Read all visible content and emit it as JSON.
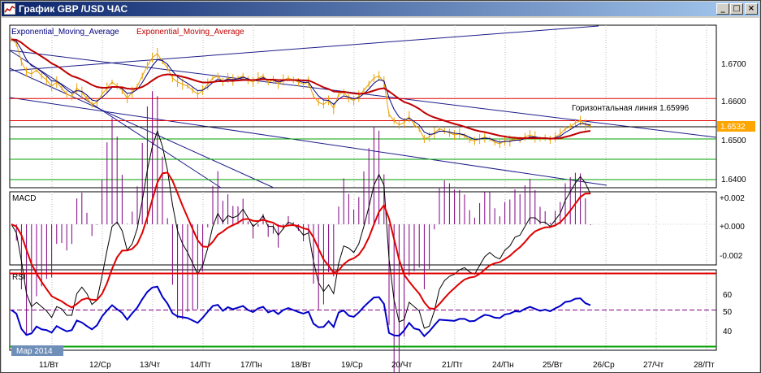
{
  "window": {
    "title": "График GBP /USD  ЧАС",
    "minimize": "_",
    "restore": "□",
    "close": "×"
  },
  "legend": {
    "ema1": "Exponential_Moving_Average",
    "ema2": "Exponential_Moving_Average",
    "ema1_color": "#000080",
    "ema2_color": "#c00000"
  },
  "price_axis": {
    "ticks": [
      "1.6700",
      "1.6600",
      "1.6500",
      "1.6400"
    ],
    "current_price": "1.6532",
    "current_price_color": "#ffa500"
  },
  "annotation": {
    "horizontal_line_label": "Горизонтальная линия 1.65996"
  },
  "macd": {
    "label": "MACD",
    "ticks": [
      "+0.002",
      "+0.000",
      "-0.002"
    ]
  },
  "rsi": {
    "label": "RSI",
    "ticks": [
      "60",
      "50",
      "40"
    ]
  },
  "time_axis": {
    "month_label": "Мар 2014",
    "ticks": [
      "11/Вт",
      "12/Ср",
      "13/Чт",
      "14/Пт",
      "17/Пн",
      "18/Вт",
      "19/Ср",
      "20/Чт",
      "21/Пт",
      "24/Пн",
      "25/Вт",
      "26/Ср",
      "27/Чт",
      "28/Пт"
    ]
  },
  "chart_data": {
    "type": "line",
    "symbol": "GBP/USD",
    "timeframe": "hourly",
    "price_range": [
      1.638,
      1.678
    ],
    "series": [
      {
        "name": "Exponential_Moving_Average",
        "color": "#000080"
      },
      {
        "name": "Exponential_Moving_Average",
        "color": "#c00000"
      }
    ],
    "horizontal_levels": [
      {
        "value": 1.65996,
        "color": "#e00000"
      },
      {
        "value": 1.6545,
        "color": "#e00000"
      },
      {
        "value": 1.653,
        "color": "#000000"
      },
      {
        "value": 1.65,
        "color": "#00a000"
      },
      {
        "value": 1.645,
        "color": "#00a000"
      },
      {
        "value": 1.64,
        "color": "#00a000"
      }
    ],
    "close_prices": [
      1.6745,
      1.6735,
      1.669,
      1.6665,
      1.666,
      1.667,
      1.6655,
      1.6645,
      1.663,
      1.664,
      1.6625,
      1.661,
      1.6605,
      1.6625,
      1.6615,
      1.66,
      1.6585,
      1.659,
      1.661,
      1.6625,
      1.664,
      1.663,
      1.662,
      1.66,
      1.6615,
      1.663,
      1.6655,
      1.668,
      1.67,
      1.671,
      1.669,
      1.6675,
      1.665,
      1.664,
      1.6635,
      1.663,
      1.662,
      1.661,
      1.662,
      1.6635,
      1.665,
      1.6655,
      1.664,
      1.665,
      1.6645,
      1.665,
      1.6655,
      1.6645,
      1.664,
      1.665,
      1.6655,
      1.664,
      1.6645,
      1.6635,
      1.6645,
      1.665,
      1.6645,
      1.664,
      1.6635,
      1.664,
      1.6605,
      1.659,
      1.6585,
      1.6595,
      1.6575,
      1.661,
      1.6615,
      1.66,
      1.6595,
      1.6605,
      1.662,
      1.6635,
      1.665,
      1.6655,
      1.664,
      1.656,
      1.6545,
      1.6535,
      1.654,
      1.6555,
      1.6535,
      1.6525,
      1.65,
      1.6505,
      1.6515,
      1.6525,
      1.652,
      1.6515,
      1.651,
      1.6512,
      1.6508,
      1.6498,
      1.6495,
      1.65,
      1.6505,
      1.65,
      1.6492,
      1.6488,
      1.6495,
      1.6495,
      1.65,
      1.6498,
      1.6505,
      1.651,
      1.6505,
      1.65,
      1.6503,
      1.6498,
      1.6505,
      1.6512,
      1.6525,
      1.653,
      1.654,
      1.6545,
      1.6535,
      1.6532
    ],
    "ema_fast": [
      1.6745,
      1.674,
      1.672,
      1.6695,
      1.668,
      1.6675,
      1.6665,
      1.6655,
      1.6643,
      1.6642,
      1.6633,
      1.6621,
      1.6613,
      1.6619,
      1.6617,
      1.6608,
      1.6596,
      1.6593,
      1.6602,
      1.6614,
      1.6627,
      1.6629,
      1.6624,
      1.6612,
      1.6614,
      1.6622,
      1.6639,
      1.666,
      1.668,
      1.6695,
      1.6693,
      1.6684,
      1.6667,
      1.6653,
      1.6644,
      1.6637,
      1.6628,
      1.6619,
      1.662,
      1.6628,
      1.6639,
      1.6647,
      1.6643,
      1.6647,
      1.6646,
      1.6648,
      1.6652,
      1.6648,
      1.6644,
      1.6647,
      1.6651,
      1.6645,
      1.6645,
      1.664,
      1.6643,
      1.6646,
      1.6645,
      1.6643,
      1.6639,
      1.664,
      1.6622,
      1.6606,
      1.6596,
      1.6595,
      1.6585,
      1.6598,
      1.6606,
      1.6603,
      1.6599,
      1.6602,
      1.6611,
      1.6623,
      1.6637,
      1.6646,
      1.6643,
      1.6601,
      1.6573,
      1.6554,
      1.6547,
      1.6551,
      1.6543,
      1.6534,
      1.6517,
      1.6511,
      1.6513,
      1.6519,
      1.6519,
      1.6517,
      1.6514,
      1.6513,
      1.651,
      1.6504,
      1.6499,
      1.65,
      1.6502,
      1.6501,
      1.6496,
      1.6492,
      1.6494,
      1.6494,
      1.6497,
      1.6497,
      1.6501,
      1.6505,
      1.6505,
      1.6503,
      1.6503,
      1.65,
      1.6503,
      1.6507,
      1.6516,
      1.6523,
      1.6531,
      1.6538,
      1.6537,
      1.6534
    ],
    "ema_slow": [
      1.6745,
      1.6744,
      1.6737,
      1.6727,
      1.6718,
      1.6711,
      1.6703,
      1.6695,
      1.6686,
      1.668,
      1.6672,
      1.6663,
      1.6655,
      1.6651,
      1.6646,
      1.664,
      1.6633,
      1.6628,
      1.6626,
      1.6626,
      1.6628,
      1.6628,
      1.6627,
      1.6624,
      1.6623,
      1.6624,
      1.6628,
      1.6635,
      1.6644,
      1.6652,
      1.6657,
      1.6659,
      1.6658,
      1.6656,
      1.6653,
      1.665,
      1.6646,
      1.6642,
      1.6639,
      1.6639,
      1.664,
      1.6642,
      1.6642,
      1.6643,
      1.6643,
      1.6644,
      1.6645,
      1.6645,
      1.6645,
      1.6646,
      1.6647,
      1.6646,
      1.6646,
      1.6645,
      1.6645,
      1.6645,
      1.6645,
      1.6645,
      1.6644,
      1.6644,
      1.6639,
      1.6633,
      1.6627,
      1.6623,
      1.6617,
      1.6616,
      1.6616,
      1.6614,
      1.6612,
      1.6611,
      1.6612,
      1.6615,
      1.6619,
      1.6623,
      1.6625,
      1.6617,
      1.6608,
      1.6599,
      1.6591,
      1.6587,
      1.6581,
      1.6574,
      1.6565,
      1.6558,
      1.6553,
      1.6549,
      1.6545,
      1.6541,
      1.6537,
      1.6534,
      1.653,
      1.6526,
      1.6522,
      1.6519,
      1.6517,
      1.6514,
      1.6511,
      1.6508,
      1.6506,
      1.6504,
      1.6503,
      1.6502,
      1.6502,
      1.6502,
      1.6502,
      1.6502,
      1.6502,
      1.6501,
      1.6501,
      1.6502,
      1.6505,
      1.6508,
      1.6512,
      1.6516,
      1.6518,
      1.652
    ],
    "macd_range": [
      -0.003,
      0.0024
    ],
    "rsi_range": [
      28,
      72
    ],
    "rsi_levels": [
      {
        "value": 70,
        "color": "#e00000"
      },
      {
        "value": 50,
        "color": "#800080"
      },
      {
        "value": 30,
        "color": "#00a000"
      }
    ]
  }
}
